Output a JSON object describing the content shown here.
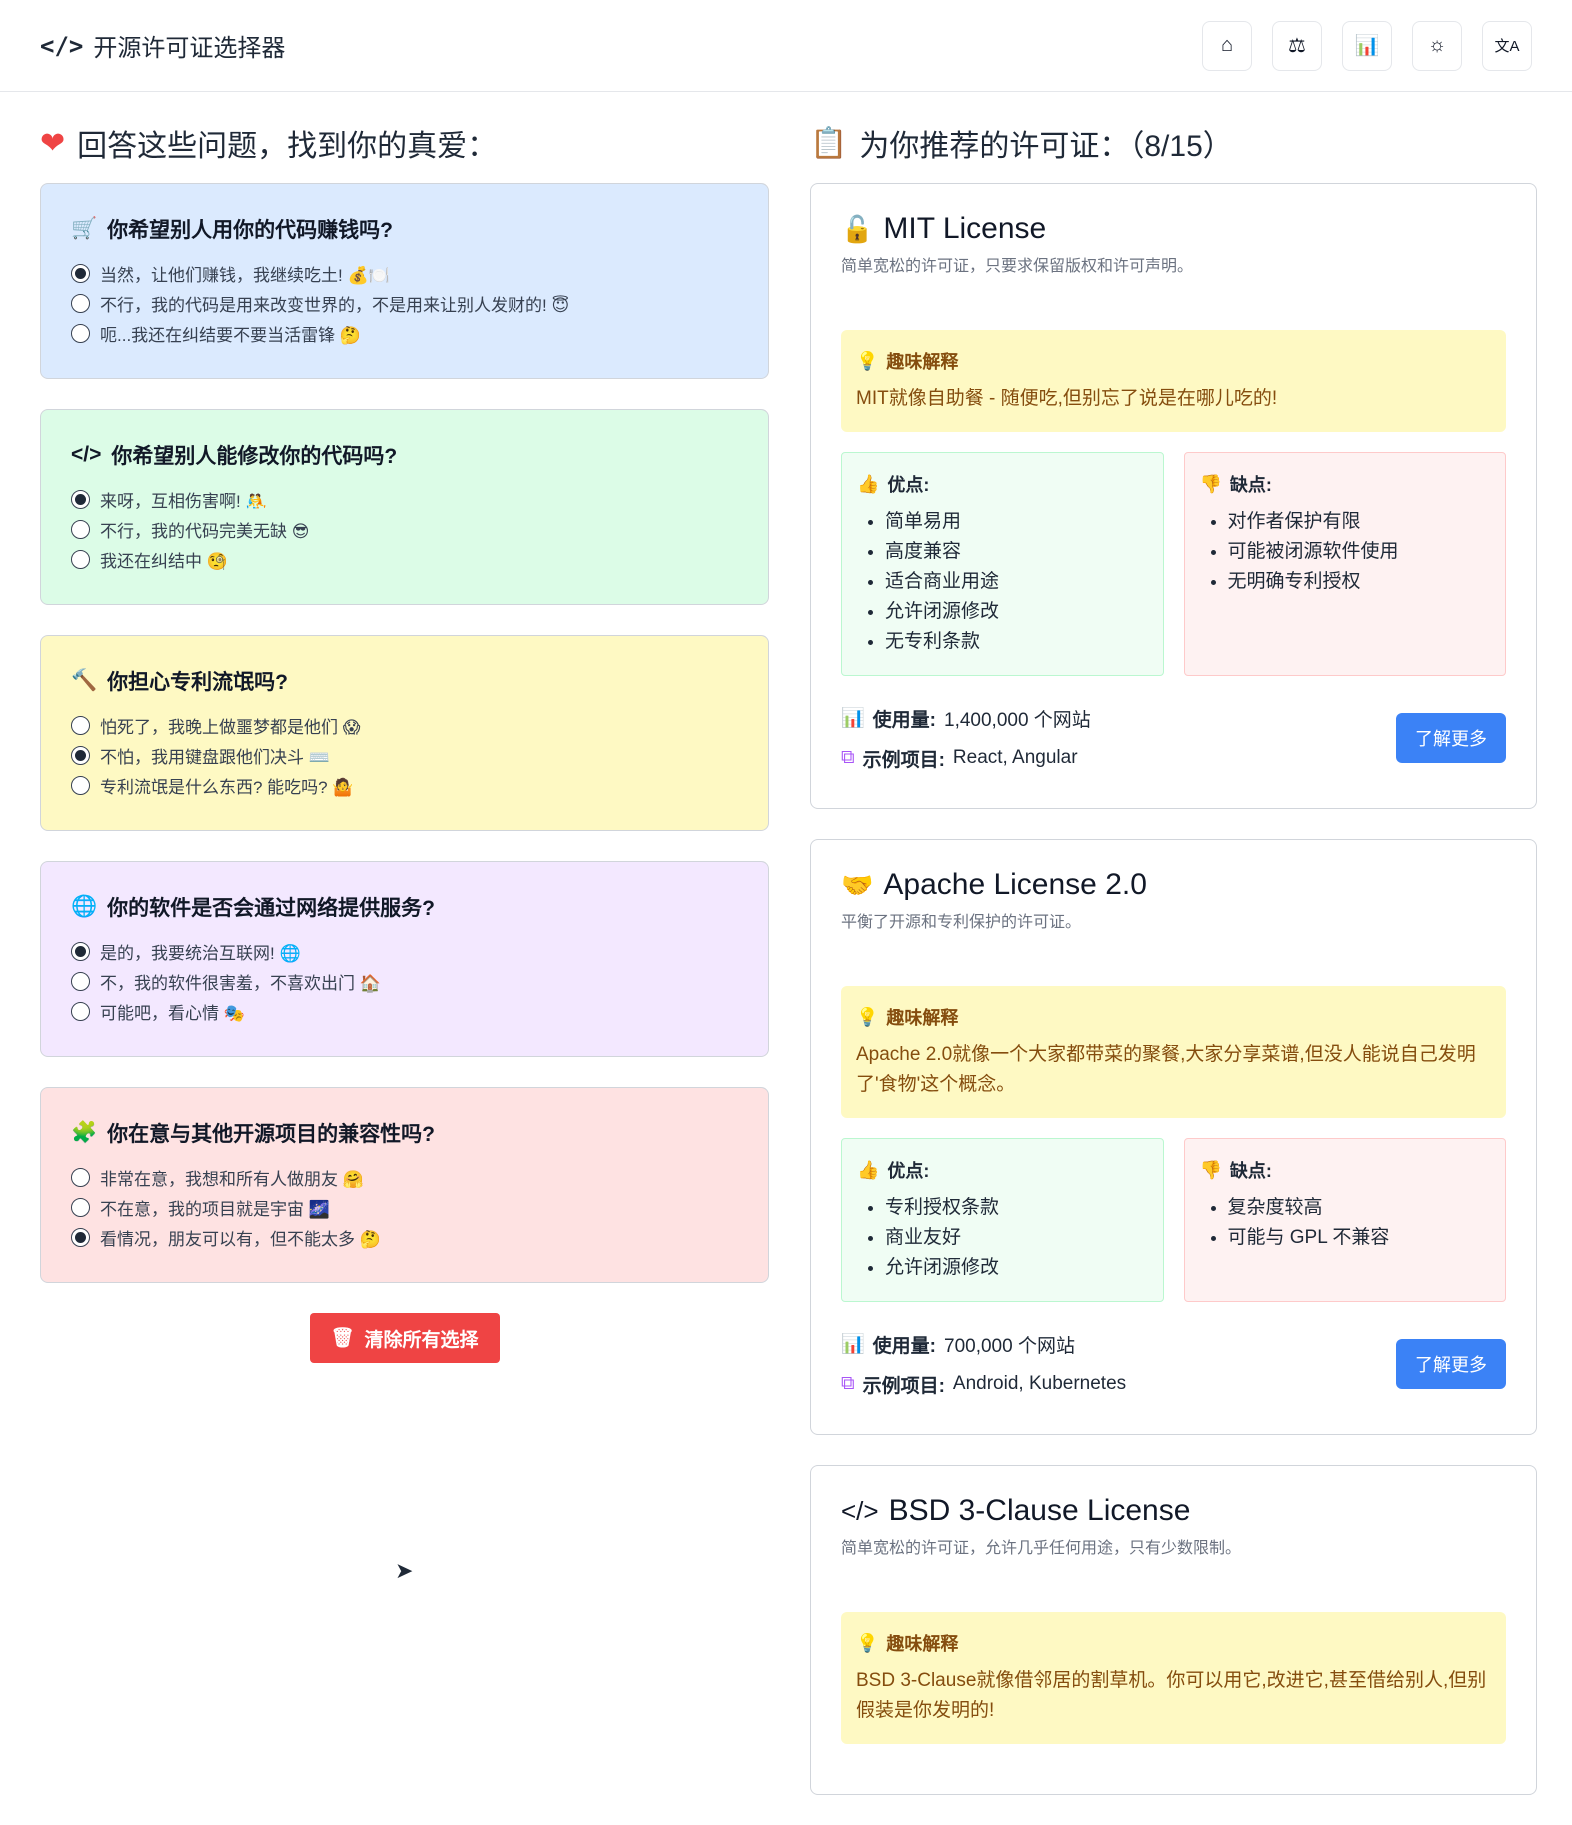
{
  "header": {
    "title": "开源许可证选择器",
    "nav": [
      {
        "icon": "home-icon",
        "glyph": "⌂"
      },
      {
        "icon": "scale-icon",
        "glyph": "⚖"
      },
      {
        "icon": "chart-icon",
        "glyph": "📊"
      },
      {
        "icon": "sun-icon",
        "glyph": "☼"
      },
      {
        "icon": "translate-icon",
        "glyph": "文A"
      }
    ]
  },
  "left": {
    "title": "回答这些问题，找到你的真爱：",
    "clear_label": "清除所有选择",
    "questions": [
      {
        "bg": "#dbeafe",
        "icon": "🛒",
        "title": "你希望别人用你的代码赚钱吗?",
        "options": [
          "当然，让他们赚钱，我继续吃土! 💰🍽️",
          "不行，我的代码是用来改变世界的，不是用来让别人发财的! 😇",
          "呃...我还在纠结要不要当活雷锋 🤔"
        ],
        "selected": 0
      },
      {
        "bg": "#dcfce7",
        "icon": "</>",
        "title": "你希望别人能修改你的代码吗?",
        "options": [
          "来呀，互相伤害啊! 🤼",
          "不行，我的代码完美无缺 😎",
          "我还在纠结中 🧐"
        ],
        "selected": 0
      },
      {
        "bg": "#fef9c3",
        "icon": "🔨",
        "title": "你担心专利流氓吗?",
        "options": [
          "怕死了，我晚上做噩梦都是他们 😱",
          "不怕，我用键盘跟他们决斗 ⌨️",
          "专利流氓是什么东西? 能吃吗? 🤷"
        ],
        "selected": 1
      },
      {
        "bg": "#f3e8ff",
        "icon": "🌐",
        "title": "你的软件是否会通过网络提供服务?",
        "options": [
          "是的，我要统治互联网! 🌐",
          "不，我的软件很害羞，不喜欢出门 🏠",
          "可能吧，看心情 🎭"
        ],
        "selected": 0
      },
      {
        "bg": "#fee2e2",
        "icon": "🧩",
        "title": "你在意与其他开源项目的兼容性吗?",
        "options": [
          "非常在意，我想和所有人做朋友 🤗",
          "不在意，我的项目就是宇宙 🌌",
          "看情况，朋友可以有，但不能太多 🤔"
        ],
        "selected": 2
      }
    ]
  },
  "right": {
    "title": "为你推荐的许可证：（8/15）",
    "fun_label": "趣味解释",
    "pros_label": "优点:",
    "cons_label": "缺点:",
    "usage_label": "使用量:",
    "examples_label": "示例项目:",
    "more_label": "了解更多",
    "licenses": [
      {
        "icon": "🔓",
        "name": "MIT License",
        "desc": "简单宽松的许可证，只要求保留版权和许可声明。",
        "fun": "MIT就像自助餐 - 随便吃,但别忘了说是在哪儿吃的!",
        "pros": [
          "简单易用",
          "高度兼容",
          "适合商业用途",
          "允许闭源修改",
          "无专利条款"
        ],
        "cons": [
          "对作者保护有限",
          "可能被闭源软件使用",
          "无明确专利授权"
        ],
        "usage": "1,400,000 个网站",
        "examples": "React, Angular"
      },
      {
        "icon": "🤝",
        "name": "Apache License 2.0",
        "desc": "平衡了开源和专利保护的许可证。",
        "fun": "Apache 2.0就像一个大家都带菜的聚餐,大家分享菜谱,但没人能说自己发明了'食物'这个概念。",
        "pros": [
          "专利授权条款",
          "商业友好",
          "允许闭源修改"
        ],
        "cons": [
          "复杂度较高",
          "可能与 GPL 不兼容"
        ],
        "usage": "700,000 个网站",
        "examples": "Android, Kubernetes"
      },
      {
        "icon": "</>",
        "name": "BSD 3-Clause License",
        "desc": "简单宽松的许可证，允许几乎任何用途，只有少数限制。",
        "fun": "BSD 3-Clause就像借邻居的割草机。你可以用它,改进它,甚至借给别人,但别假装是你发明的!"
      }
    ]
  }
}
